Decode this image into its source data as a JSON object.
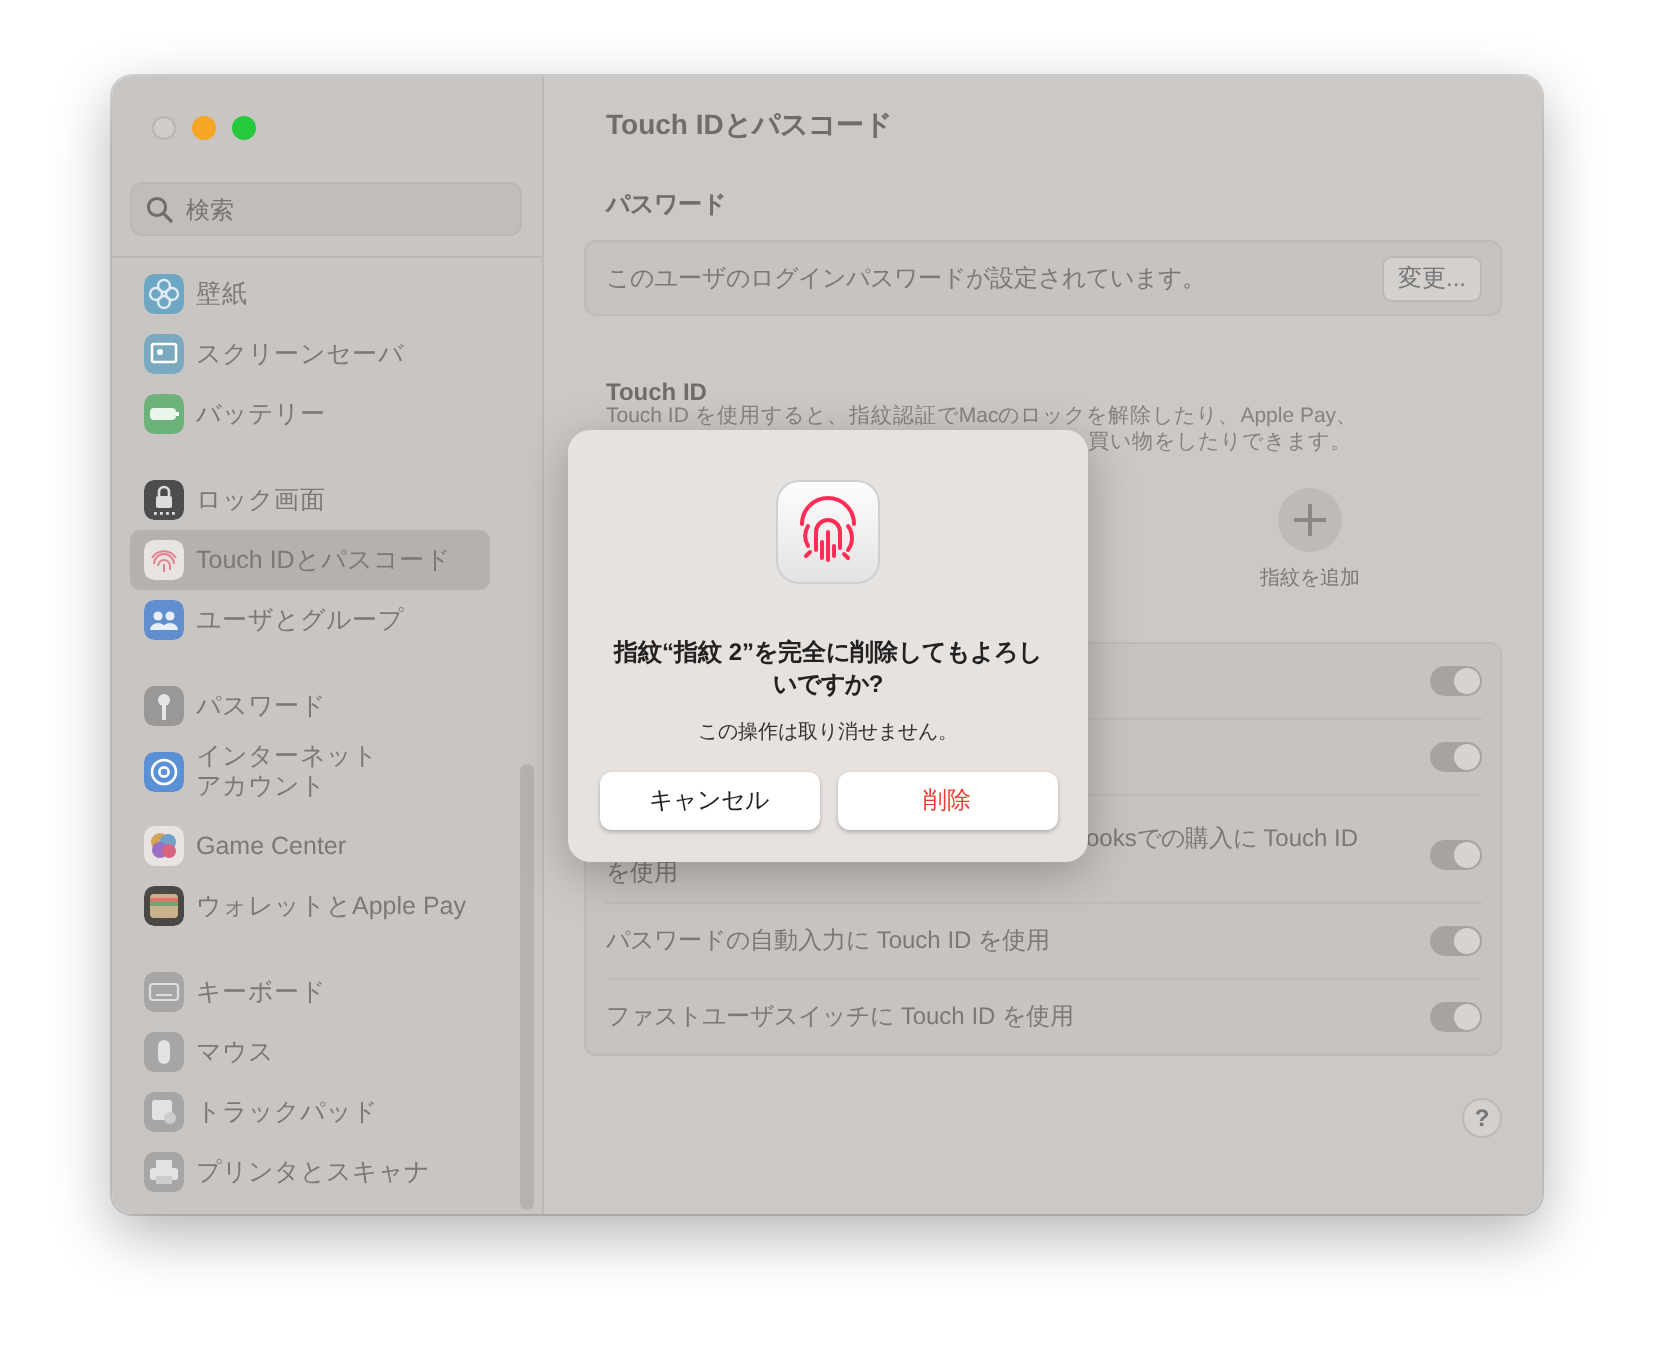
{
  "sidebar": {
    "search": {
      "placeholder": "検索"
    },
    "groups": [
      {
        "items": [
          {
            "label": "壁紙",
            "color": "#6ea7c4",
            "selected": false
          },
          {
            "label": "スクリーンセーバ",
            "color": "#7aa9c0",
            "selected": false
          },
          {
            "label": "バッテリー",
            "color": "#6cb27a",
            "selected": false
          }
        ]
      },
      {
        "items": [
          {
            "label": "ロック画面",
            "color": "#4e4d4d",
            "selected": false
          },
          {
            "label": "Touch IDとパスコード",
            "color": "#e8e4e2",
            "selected": true
          },
          {
            "label": "ユーザとグループ",
            "color": "#5f8fcf",
            "selected": false
          }
        ]
      },
      {
        "items": [
          {
            "label": "パスワード",
            "color": "#9a9896",
            "selected": false
          },
          {
            "label_lines": [
              "インターネット",
              "アカウント"
            ],
            "color": "#5b8fd6",
            "selected": false
          },
          {
            "label": "Game Center",
            "color": "#e8e4e2",
            "selected": false
          },
          {
            "label": "ウォレットとApple Pay",
            "color": "#4a4948",
            "selected": false
          }
        ]
      },
      {
        "items": [
          {
            "label": "キーボード",
            "color": "#a8a6a4",
            "selected": false
          },
          {
            "label": "マウス",
            "color": "#a8a6a4",
            "selected": false
          },
          {
            "label": "トラックパッド",
            "color": "#a8a6a4",
            "selected": false
          },
          {
            "label": "プリンタとスキャナ",
            "color": "#a8a6a4",
            "selected": false
          }
        ]
      }
    ]
  },
  "pane": {
    "title": "Touch IDとパスコード",
    "password": {
      "heading": "パスワード",
      "message": "このユーザのログインパスワードが設定されています。",
      "button": "変更..."
    },
    "touch_id": {
      "heading": "Touch ID",
      "description_lines": [
        "Touch ID を使用すると、指紋認証でMacのロックを解除したり、Apple Pay、",
        "買い物をしたりできます。"
      ]
    },
    "add_fingerprint": {
      "label": "指紋を追加"
    },
    "options": [
      {
        "on": true
      },
      {
        "on": true
      },
      {
        "label_lines": [
          "ooksでの購入に Touch ID",
          "を使用"
        ],
        "on": true
      },
      {
        "label_lines": [
          "パスワードの自動入力に Touch ID を使用"
        ],
        "on": true
      },
      {
        "label_lines": [
          "ファストユーザスイッチに Touch ID を使用"
        ],
        "on": true
      }
    ],
    "help_button": "?"
  },
  "dialog": {
    "title": "指紋“指紋 2”を完全に削除してもよろしいですか?",
    "message": "この操作は取り消せません。",
    "buttons": [
      {
        "label": "キャンセル",
        "kind": "cancel"
      },
      {
        "label": "削除",
        "kind": "destructive"
      }
    ]
  }
}
